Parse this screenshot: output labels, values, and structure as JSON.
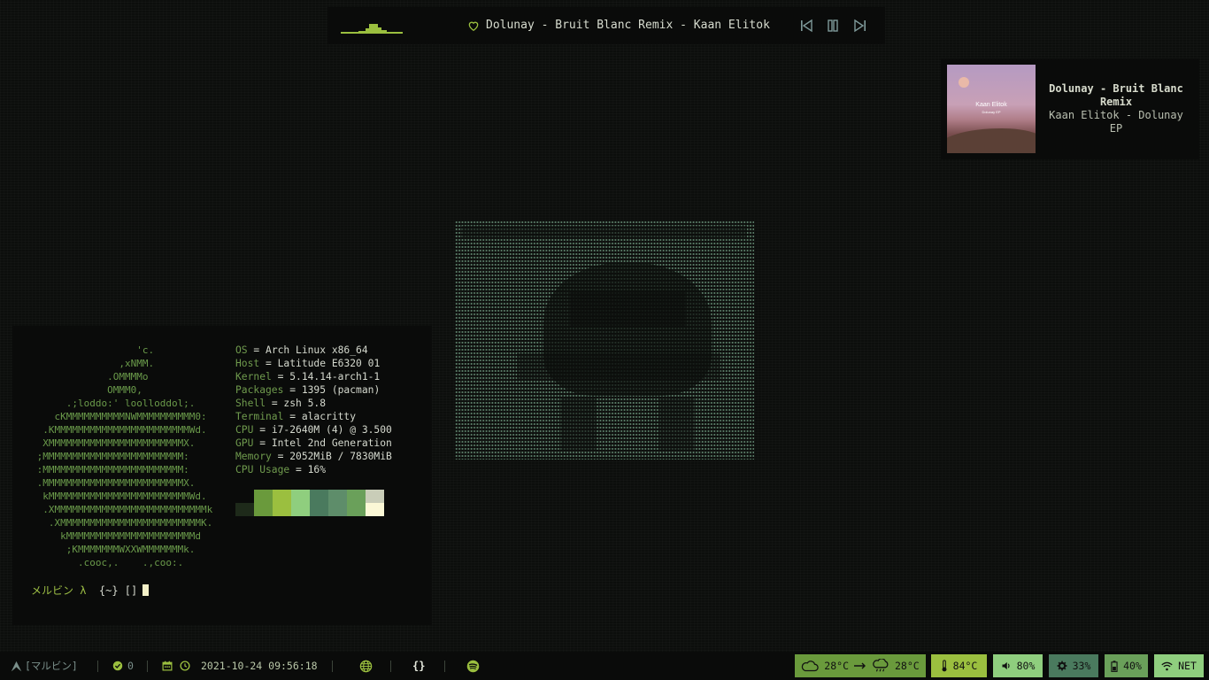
{
  "music_bar": {
    "track_title": "Dolunay - Bruit Blanc Remix - Kaan Elitok",
    "icons": {
      "like": "heart-icon",
      "prev": "skip-previous-icon",
      "pause": "pause-icon",
      "next": "skip-next-icon"
    }
  },
  "now_playing": {
    "title": "Dolunay - Bruit Blanc Remix",
    "artist_album": "Kaan Elitok - Dolunay EP",
    "album_art_artist": "Kaan Elitok",
    "album_art_album": "Dolunay EP"
  },
  "terminal": {
    "logo": "                  'c.\n               ,xNMM.\n             .OMMMMo\n             OMMM0,\n      .;loddo:' loolloddol;.\n    cKMMMMMMMMMMNWMMMMMMMMMM0:\n  .KMMMMMMMMMMMMMMMMMMMMMMMWd.\n  XMMMMMMMMMMMMMMMMMMMMMMMX.\n ;MMMMMMMMMMMMMMMMMMMMMMMM:\n :MMMMMMMMMMMMMMMMMMMMMMMM:\n .MMMMMMMMMMMMMMMMMMMMMMMMX.\n  kMMMMMMMMMMMMMMMMMMMMMMMMWd.\n  .XMMMMMMMMMMMMMMMMMMMMMMMMMMk\n   .XMMMMMMMMMMMMMMMMMMMMMMMMK.\n     kMMMMMMMMMMMMMMMMMMMMMMd\n      ;KMMMMMMMWXXWMMMMMMMk.\n        .cooc,.    .,coo:.",
    "info": [
      {
        "key": "OS",
        "value": "Arch Linux x86_64"
      },
      {
        "key": "Host",
        "value": "Latitude E6320 01"
      },
      {
        "key": "Kernel",
        "value": "5.14.14-arch1-1"
      },
      {
        "key": "Packages",
        "value": "1395 (pacman)"
      },
      {
        "key": "Shell",
        "value": "zsh 5.8"
      },
      {
        "key": "Terminal",
        "value": "alacritty"
      },
      {
        "key": "CPU",
        "value": "i7-2640M (4) @ 3.500"
      },
      {
        "key": "GPU",
        "value": "Intel 2nd Generation"
      },
      {
        "key": "Memory",
        "value": "2052MiB / 7830MiB"
      },
      {
        "key": "CPU Usage",
        "value": "16%"
      }
    ],
    "palette": {
      "top": [
        "#0a0b0a",
        "#6a9a3c",
        "#9bbf3f",
        "#8fce7e",
        "#4a7a5e",
        "#5e8d6a",
        "#6aa05a",
        "#c9cdb8"
      ],
      "bottom": [
        "#1e2a1a",
        "#6a9a3c",
        "#9bbf3f",
        "#8fce7e",
        "#4a7a5e",
        "#5e8d6a",
        "#6aa05a",
        "#fbf8d6"
      ]
    },
    "prompt_user": "メルビン λ",
    "prompt_cwd": "{~} []"
  },
  "bottom_bar": {
    "workspace": "[マルビン]",
    "updates": "0",
    "datetime": "2021-10-24 09:56:18",
    "dev_label": "{}",
    "weather_now": "28°C",
    "weather_later": "28°C",
    "temperature": "84°C",
    "volume": "80%",
    "cpu": "33%",
    "battery": "40%",
    "network": "NET",
    "colors": {
      "weather": "#6a9a3c",
      "temp": "#9bbf3f",
      "volume": "#8fce7e",
      "cpu": "#4a7a5e",
      "battery": "#6aa05a",
      "net": "#8fce7e"
    }
  }
}
